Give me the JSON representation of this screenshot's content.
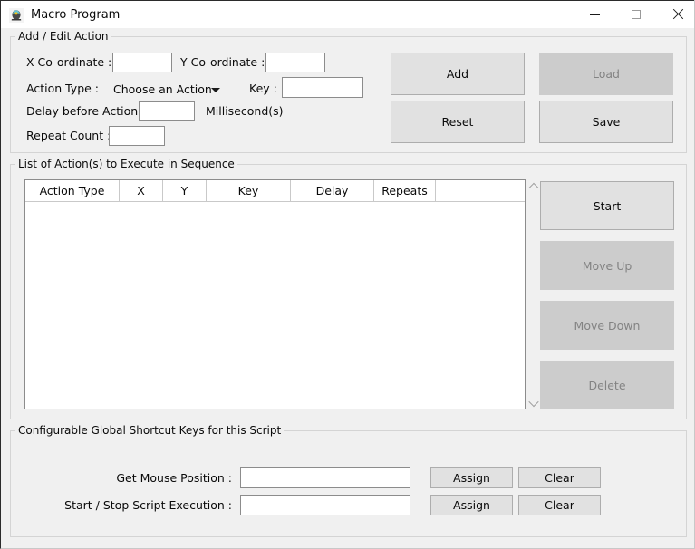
{
  "window": {
    "title": "Macro Program",
    "icon": "app-icon",
    "controls": {
      "minimize": "minimize-icon",
      "maximize": "maximize-icon",
      "close": "close-icon"
    }
  },
  "add_edit_group": {
    "legend": "Add / Edit Action",
    "labels": {
      "x_coordinate": "X Co-ordinate :",
      "y_coordinate": "Y Co-ordinate :",
      "action_type": "Action Type :",
      "key": "Key :",
      "delay": "Delay before Action :",
      "milliseconds": "Millisecond(s)",
      "repeat_count": "Repeat Count :"
    },
    "fields": {
      "x_coordinate_value": "",
      "x_coordinate_placeholder": "",
      "y_coordinate_value": "",
      "y_coordinate_placeholder": "",
      "key_value": "",
      "key_placeholder": "",
      "delay_value": "",
      "delay_placeholder": "",
      "repeat_value": "",
      "repeat_placeholder": ""
    },
    "action_type_selected": "Choose an Action",
    "action_type_arrow": "chevron-down-icon",
    "buttons": [
      {
        "label": "Add",
        "enabled": true
      },
      {
        "label": "Load",
        "enabled": false
      },
      {
        "label": "Reset",
        "enabled": true
      },
      {
        "label": "Save",
        "enabled": true
      }
    ]
  },
  "list_group": {
    "legend": "List of Action(s) to Execute in Sequence",
    "columns": [
      "Action Type",
      "X",
      "Y",
      "Key",
      "Delay",
      "Repeats",
      ""
    ],
    "rows": [],
    "scrollbar": {
      "up_arrow": "chevron-up-icon",
      "down_arrow": "chevron-down-icon"
    },
    "buttons": [
      {
        "label": "Start",
        "enabled": true
      },
      {
        "label": "Move Up",
        "enabled": false
      },
      {
        "label": "Move Down",
        "enabled": false
      },
      {
        "label": "Delete",
        "enabled": false
      }
    ]
  },
  "shortcut_group": {
    "legend": "Configurable Global Shortcut Keys for this Script",
    "rows": [
      {
        "label": "Get Mouse Position :",
        "value": "",
        "placeholder": "",
        "assign_label": "Assign",
        "clear_label": "Clear"
      },
      {
        "label": "Start / Stop Script Execution :",
        "value": "",
        "placeholder": "",
        "assign_label": "Assign",
        "clear_label": "Clear"
      }
    ]
  },
  "colors": {
    "window_bg": "#f0f0f0",
    "titlebar_bg": "#ffffff",
    "button_enabled_bg": "#e1e1e1",
    "button_disabled_bg": "#cccccc",
    "button_disabled_text": "#838383",
    "field_bg": "#ffffff",
    "field_border": "#8c8c8c",
    "group_border": "#d4d4d4",
    "text": "#0a0a0a"
  }
}
